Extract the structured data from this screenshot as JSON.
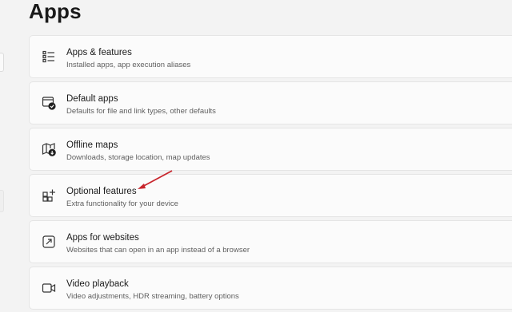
{
  "page": {
    "title": "Apps"
  },
  "items": [
    {
      "label": "Apps & features",
      "description": "Installed apps, app execution aliases",
      "icon": "apps-list-icon"
    },
    {
      "label": "Default apps",
      "description": "Defaults for file and link types, other defaults",
      "icon": "default-apps-icon"
    },
    {
      "label": "Offline maps",
      "description": "Downloads, storage location, map updates",
      "icon": "offline-maps-icon"
    },
    {
      "label": "Optional features",
      "description": "Extra functionality for your device",
      "icon": "optional-features-icon"
    },
    {
      "label": "Apps for websites",
      "description": "Websites that can open in an app instead of a browser",
      "icon": "apps-for-websites-icon"
    },
    {
      "label": "Video playback",
      "description": "Video adjustments, HDR streaming, battery options",
      "icon": "video-playback-icon"
    }
  ],
  "annotation": {
    "arrow_color": "#c8252c",
    "points_to": "Optional features"
  }
}
